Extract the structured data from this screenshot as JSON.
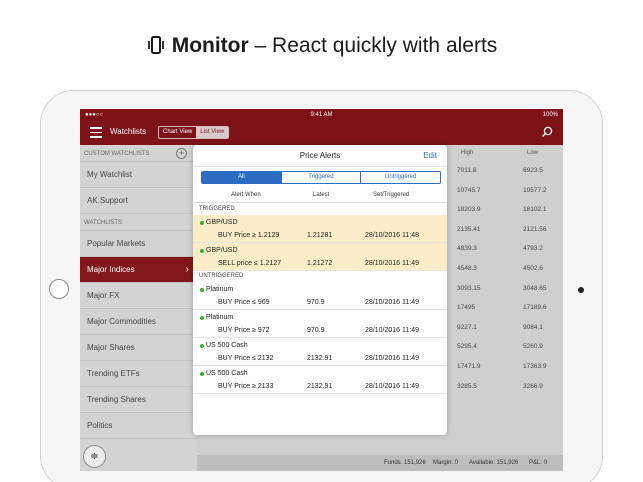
{
  "headline": {
    "bold": "Monitor",
    "rest": "– React quickly with alerts"
  },
  "status": {
    "carrier": "●●●○○ ",
    "time": "9:41 AM",
    "battery": "100%"
  },
  "nav": {
    "title": "Watchlists",
    "view_chart": "Chart View",
    "view_list": "List View"
  },
  "sidebar": {
    "section_custom": "CUSTOM WATCHLISTS",
    "custom_items": [
      "My Watchlist",
      "AK.Support"
    ],
    "section_watchlists": "WATCHLISTS",
    "items": [
      "Popular Markets",
      "Major Indices",
      "Major FX",
      "Major Commodities",
      "Major Shares",
      "Trending ETFs",
      "Trending Shares",
      "Politics"
    ],
    "active_index": 1
  },
  "background_table": {
    "col_high": "High",
    "col_low": "Low",
    "rows": [
      [
        "7011.8",
        "6923.5"
      ],
      [
        "10745.7",
        "10577.2"
      ],
      [
        "18203.9",
        "18102.1"
      ],
      [
        "2135.41",
        "2121.56"
      ],
      [
        "4839.3",
        "4793.2"
      ],
      [
        "4548.3",
        "4502.6"
      ],
      [
        "3093.15",
        "3048.65"
      ],
      [
        "17495",
        "17189.6"
      ],
      [
        "9227.1",
        "9084.1"
      ],
      [
        "5295.4",
        "5260.9"
      ],
      [
        "17471.9",
        "17363.9"
      ],
      [
        "3285.5",
        "3266.9"
      ]
    ]
  },
  "footer": {
    "funds": "Funds: 151,926",
    "margin": "Margin: 0",
    "available": "Available: 151,926",
    "pl": "P&L: 0"
  },
  "modal": {
    "title": "Price Alerts",
    "edit": "Edit",
    "tabs": [
      "All",
      "Triggered",
      "Untriggered"
    ],
    "col_alert_when": "Alert When",
    "col_latest": "Latest",
    "col_set": "Set/Triggered",
    "section_triggered": "TRIGGERED",
    "section_untriggered": "UNTRIGGERED",
    "triggered": [
      {
        "name": "GBP/USD",
        "cond": "BUY Price ≥ 1.2129",
        "latest": "1.21281",
        "set": "28/10/2016 11:48"
      },
      {
        "name": "GBP/USD",
        "cond": "SELL price ≤ 1.2127",
        "latest": "1.21272",
        "set": "28/10/2016 11:49"
      }
    ],
    "untriggered": [
      {
        "name": "Platinum",
        "cond": "BUY Price ≤ 969",
        "latest": "970.9",
        "set": "28/10/2016 11:49"
      },
      {
        "name": "Platinum",
        "cond": "BUY Price ≥ 972",
        "latest": "970.9",
        "set": "28/10/2016 11:49"
      },
      {
        "name": "US 500 Cash",
        "cond": "BUY Price ≤ 2132",
        "latest": "2132.91",
        "set": "28/10/2016 11:49"
      },
      {
        "name": "US 500 Cash",
        "cond": "BUY Price ≥ 2133",
        "latest": "2132.91",
        "set": "28/10/2016 11:49"
      }
    ]
  },
  "colors": {
    "brand": "#7d1318",
    "accent": "#2d6cc3",
    "triggered_bg": "#fbedc8",
    "dot": "#3aaa35"
  }
}
